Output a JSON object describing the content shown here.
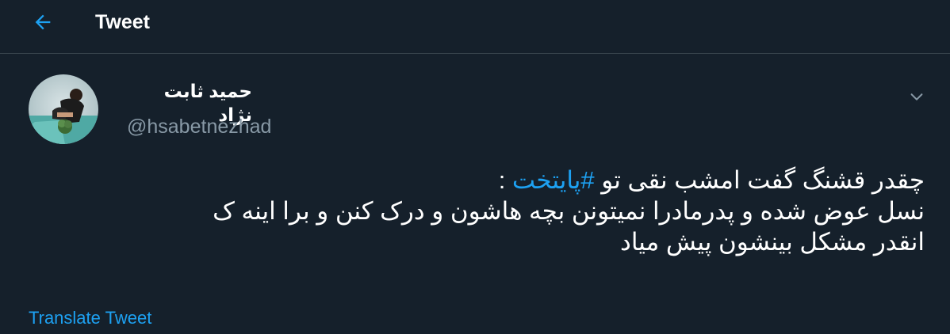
{
  "header": {
    "back_icon": "arrow-left-icon",
    "title": "Tweet"
  },
  "author": {
    "display_name": "حمید ثابت نژاد",
    "handle": "@hsabetnezhad",
    "avatar_icon": "profile-photo"
  },
  "menu": {
    "caret_icon": "chevron-down-icon"
  },
  "tweet": {
    "line1_before": "چقدر قشنگ گفت امشب نقی تو ",
    "hashtag": "#پایتخت",
    "line1_after": " :",
    "line2": "نسل عوض شده و پدرمادرا نمیتونن بچه هاشون و درک کنن و برا اینه ک",
    "line3": "انقدر مشکل بینشون پیش میاد"
  },
  "translate_label": "Translate Tweet",
  "colors": {
    "background": "#15202b",
    "accent": "#1da1f2",
    "secondary_text": "#8899a6",
    "divider": "#38444d"
  }
}
